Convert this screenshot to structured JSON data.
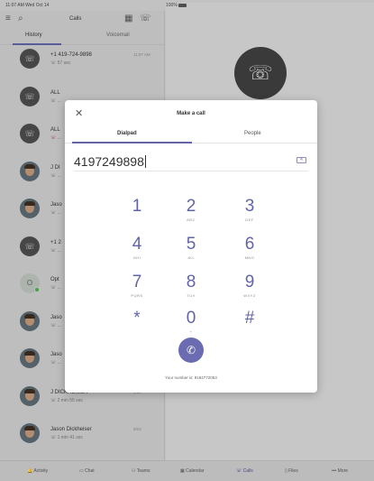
{
  "status_bar": {
    "time": "11:07 AM  Wed Oct 14",
    "center": "•",
    "right": "100%"
  },
  "header": {
    "menu_icon": "≡",
    "search_icon": "⌕",
    "title": "Calls",
    "dialpad_icon": "▦",
    "call_icon": "☏"
  },
  "left_tabs": {
    "history": "History",
    "voicemail": "Voicemail"
  },
  "history": [
    {
      "avatar": "dark",
      "name": "+1 419-724-9898",
      "sub": "☏ 57 sec",
      "time": "11:07 AM",
      "missed": false
    },
    {
      "avatar": "dark",
      "name": "ALL",
      "sub": "☏ ...",
      "time": "",
      "missed": false
    },
    {
      "avatar": "dark",
      "name": "ALL",
      "sub": "☏ ...",
      "time": "",
      "missed": true
    },
    {
      "avatar": "photo",
      "name": "J DI",
      "sub": "☏ ...",
      "time": "",
      "missed": false
    },
    {
      "avatar": "photo",
      "name": "Jaso",
      "sub": "☏ ...",
      "time": "",
      "missed": false
    },
    {
      "avatar": "dark",
      "name": "+1 2",
      "sub": "☏ ...",
      "time": "",
      "missed": false
    },
    {
      "avatar": "initials",
      "name": "Opt",
      "sub": "☏ ...",
      "time": "",
      "missed": false
    },
    {
      "avatar": "photo",
      "name": "Jaso",
      "sub": "☏ ...",
      "time": "",
      "missed": false
    },
    {
      "avatar": "photo",
      "name": "Jaso",
      "sub": "☏ ...",
      "time": "",
      "missed": false
    },
    {
      "avatar": "photo",
      "name": "J DICKHEISER",
      "sub": "☏ 2 min 55 sec",
      "time": "9/22",
      "missed": false
    },
    {
      "avatar": "photo",
      "name": "Jason Dickheiser",
      "sub": "☏ 1 min 41 sec",
      "time": "9/22",
      "missed": false
    }
  ],
  "modal": {
    "close": "✕",
    "title": "Make a call",
    "tab_dialpad": "Dialpad",
    "tab_people": "People",
    "number": "4197249898",
    "backspace_icon": "✕",
    "keys": [
      {
        "digit": "1",
        "letters": ""
      },
      {
        "digit": "2",
        "letters": "ABC"
      },
      {
        "digit": "3",
        "letters": "DEF"
      },
      {
        "digit": "4",
        "letters": "GHI"
      },
      {
        "digit": "5",
        "letters": "JKL"
      },
      {
        "digit": "6",
        "letters": "MNO"
      },
      {
        "digit": "7",
        "letters": "PQRS"
      },
      {
        "digit": "8",
        "letters": "TUV"
      },
      {
        "digit": "9",
        "letters": "WXYZ"
      },
      {
        "digit": "*",
        "letters": ""
      },
      {
        "digit": "0",
        "letters": "+"
      },
      {
        "digit": "#",
        "letters": ""
      }
    ],
    "call_icon": "✆",
    "your_number": "Your number is: 9194772063"
  },
  "bottom_nav": {
    "activity": "Activity",
    "chat": "Chat",
    "teams": "Teams",
    "calendar": "Calendar",
    "calls": "Calls",
    "files": "Files",
    "more": "More"
  },
  "colors": {
    "accent": "#6264a7",
    "call_button": "#6a6bb0"
  }
}
